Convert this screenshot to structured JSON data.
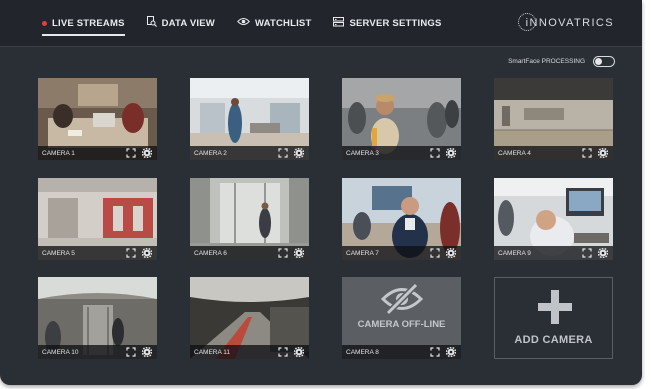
{
  "nav": {
    "items": [
      {
        "label": "LIVE STREAMS",
        "icon": "record-dot-icon",
        "active": true
      },
      {
        "label": "DATA VIEW",
        "icon": "data-search-icon",
        "active": false
      },
      {
        "label": "WATCHLIST",
        "icon": "eye-icon",
        "active": false
      },
      {
        "label": "SERVER SETTINGS",
        "icon": "server-icon",
        "active": false
      }
    ]
  },
  "brand": {
    "name": "iNNOVATRICS"
  },
  "processing": {
    "label": "SmartFace PROCESSING",
    "enabled": false
  },
  "cameras": [
    {
      "label": "CAMERA 1"
    },
    {
      "label": "CAMERA 2"
    },
    {
      "label": "CAMERA 3"
    },
    {
      "label": "CAMERA 4"
    },
    {
      "label": "CAMERA 5"
    },
    {
      "label": "CAMERA 6"
    },
    {
      "label": "CAMERA 7"
    },
    {
      "label": "CAMERA 9"
    },
    {
      "label": "CAMERA 10"
    },
    {
      "label": "CAMERA 11"
    },
    {
      "label": "CAMERA 8",
      "status": "CAMERA OFF-LINE"
    }
  ],
  "add_camera": {
    "label": "ADD CAMERA"
  },
  "colors": {
    "background": "#2a2e35",
    "topbar": "#22262c",
    "recording": "#e0413f"
  }
}
